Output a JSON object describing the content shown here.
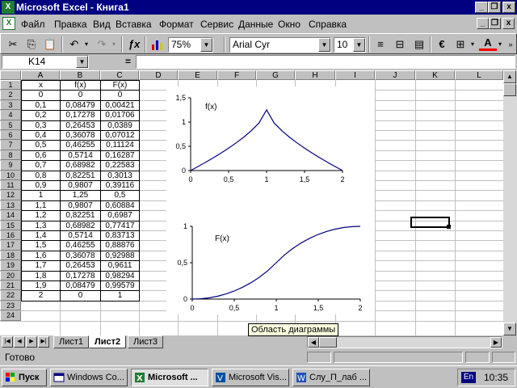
{
  "window": {
    "title": "Microsoft Excel - Книга1",
    "minimize": "_",
    "restore": "❐",
    "close": "x"
  },
  "menu": {
    "items": [
      "Файл",
      "Правка",
      "Вид",
      "Вставка",
      "Формат",
      "Сервис",
      "Данные",
      "Окно",
      "Справка"
    ]
  },
  "toolbar": {
    "zoom": "75%",
    "font": "Arial Cyr",
    "font_size": "10",
    "icons": [
      "scissors-icon",
      "copy-icon",
      "paste-icon",
      "undo-icon",
      "redo-icon",
      "function-icon",
      "chart-wizard-icon",
      "align-left-icon",
      "merge-center-icon",
      "currency-icon",
      "borders-icon",
      "font-color-icon"
    ]
  },
  "formula_bar": {
    "name_box": "K14",
    "equals": "=",
    "content": ""
  },
  "sheet": {
    "columns": [
      "A",
      "B",
      "C",
      "D",
      "E",
      "F",
      "G",
      "H",
      "I",
      "J",
      "K",
      "L"
    ],
    "rows": [
      "1",
      "2",
      "3",
      "4",
      "5",
      "6",
      "7",
      "8",
      "9",
      "10",
      "11",
      "12",
      "13",
      "14",
      "15",
      "16",
      "17",
      "18",
      "19",
      "20",
      "21",
      "22",
      "23",
      "24"
    ],
    "table": [
      [
        "x",
        "f(x)",
        "F(x)"
      ],
      [
        "0",
        "0",
        "0"
      ],
      [
        "0,1",
        "0,08479",
        "0,00421"
      ],
      [
        "0,2",
        "0,17278",
        "0,01706"
      ],
      [
        "0,3",
        "0,26453",
        "0,0389"
      ],
      [
        "0,4",
        "0,36078",
        "0,07012"
      ],
      [
        "0,5",
        "0,46255",
        "0,11124"
      ],
      [
        "0,6",
        "0,5714",
        "0,16287"
      ],
      [
        "0,7",
        "0,68982",
        "0,22583"
      ],
      [
        "0,8",
        "0,82251",
        "0,3013"
      ],
      [
        "0,9",
        "0,9807",
        "0,39116"
      ],
      [
        "1",
        "1,25",
        "0,5"
      ],
      [
        "1,1",
        "0,9807",
        "0,60884"
      ],
      [
        "1,2",
        "0,82251",
        "0,6987"
      ],
      [
        "1,3",
        "0,68982",
        "0,77417"
      ],
      [
        "1,4",
        "0,5714",
        "0,83713"
      ],
      [
        "1,5",
        "0,46255",
        "0,88876"
      ],
      [
        "1,6",
        "0,36078",
        "0,92988"
      ],
      [
        "1,7",
        "0,26453",
        "0,9611"
      ],
      [
        "1,8",
        "0,17278",
        "0,98294"
      ],
      [
        "1,9",
        "0,08479",
        "0,99579"
      ],
      [
        "2",
        "0",
        "1"
      ]
    ]
  },
  "chart_data": [
    {
      "type": "line",
      "title": "f(x)",
      "x": [
        0,
        0.1,
        0.2,
        0.3,
        0.4,
        0.5,
        0.6,
        0.7,
        0.8,
        0.9,
        1,
        1.1,
        1.2,
        1.3,
        1.4,
        1.5,
        1.6,
        1.7,
        1.8,
        1.9,
        2
      ],
      "values": [
        0,
        0.08479,
        0.17278,
        0.26453,
        0.36078,
        0.46255,
        0.5714,
        0.68982,
        0.82251,
        0.9807,
        1.25,
        0.9807,
        0.82251,
        0.68982,
        0.5714,
        0.46255,
        0.36078,
        0.26453,
        0.17278,
        0.08479,
        0
      ],
      "xlim": [
        0,
        2
      ],
      "ylim": [
        0,
        1.5
      ],
      "xticks": [
        "0",
        "0,5",
        "1",
        "1,5",
        "2"
      ],
      "yticks": [
        "0",
        "0,5",
        "1",
        "1,5"
      ],
      "grid": false
    },
    {
      "type": "line",
      "title": "F(x)",
      "x": [
        0,
        0.1,
        0.2,
        0.3,
        0.4,
        0.5,
        0.6,
        0.7,
        0.8,
        0.9,
        1,
        1.1,
        1.2,
        1.3,
        1.4,
        1.5,
        1.6,
        1.7,
        1.8,
        1.9,
        2
      ],
      "values": [
        0,
        0.00421,
        0.01706,
        0.0389,
        0.07012,
        0.11124,
        0.16287,
        0.22583,
        0.3013,
        0.39116,
        0.5,
        0.60884,
        0.6987,
        0.77417,
        0.83713,
        0.88876,
        0.92988,
        0.9611,
        0.98294,
        0.99579,
        1
      ],
      "xlim": [
        0,
        2
      ],
      "ylim": [
        0,
        1
      ],
      "xticks": [
        "0",
        "0,5",
        "1",
        "1,5",
        "2"
      ],
      "yticks": [
        "0",
        "0,5",
        "1"
      ],
      "grid": false
    }
  ],
  "tooltip": "Область диаграммы",
  "tabs": [
    "Лист1",
    "Лист2",
    "Лист3"
  ],
  "active_tab": "Лист2",
  "status": "Готово",
  "taskbar": {
    "start": "Пуск",
    "buttons": [
      "Windows Co...",
      "Microsoft ...",
      "Microsoft Vis...",
      "Слу_П_лаб ..."
    ],
    "language": "En",
    "clock": "10:35"
  }
}
